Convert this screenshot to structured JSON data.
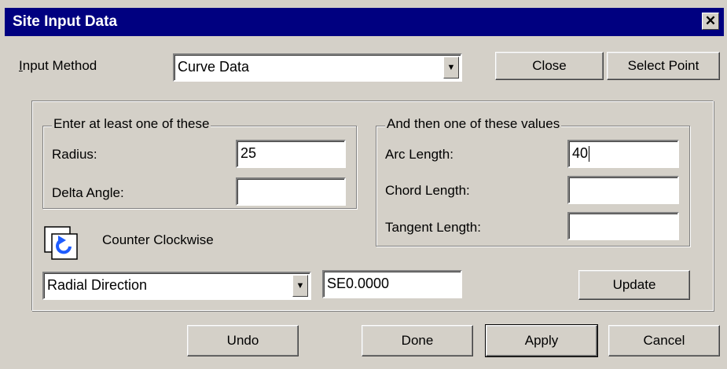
{
  "window": {
    "title": "Site Input Data",
    "close_glyph": "✕"
  },
  "top": {
    "input_method_label": "Input Method",
    "input_method_value": "Curve Data",
    "close_label": "Close",
    "select_point_label": "Select Point"
  },
  "group_left": {
    "legend": "Enter at least one of these",
    "radius_label": "Radius:",
    "radius_value": "25",
    "delta_label": "Delta Angle:",
    "delta_value": ""
  },
  "group_right": {
    "legend": "And then one of these values",
    "arc_label": "Arc Length:",
    "arc_value": "40",
    "chord_label": "Chord Length:",
    "chord_value": "",
    "tangent_label": "Tangent Length:",
    "tangent_value": ""
  },
  "direction": {
    "icon": "counter-clockwise-icon",
    "label": "Counter Clockwise",
    "radial_value": "Radial Direction",
    "bearing_value": "SE0.0000",
    "update_label": "Update"
  },
  "bottom": {
    "undo_label": "Undo",
    "done_label": "Done",
    "apply_label": "Apply",
    "cancel_label": "Cancel"
  },
  "colors": {
    "titlebar": "#000080",
    "face": "#d4d0c8",
    "icon_blue": "#1e5cff"
  }
}
